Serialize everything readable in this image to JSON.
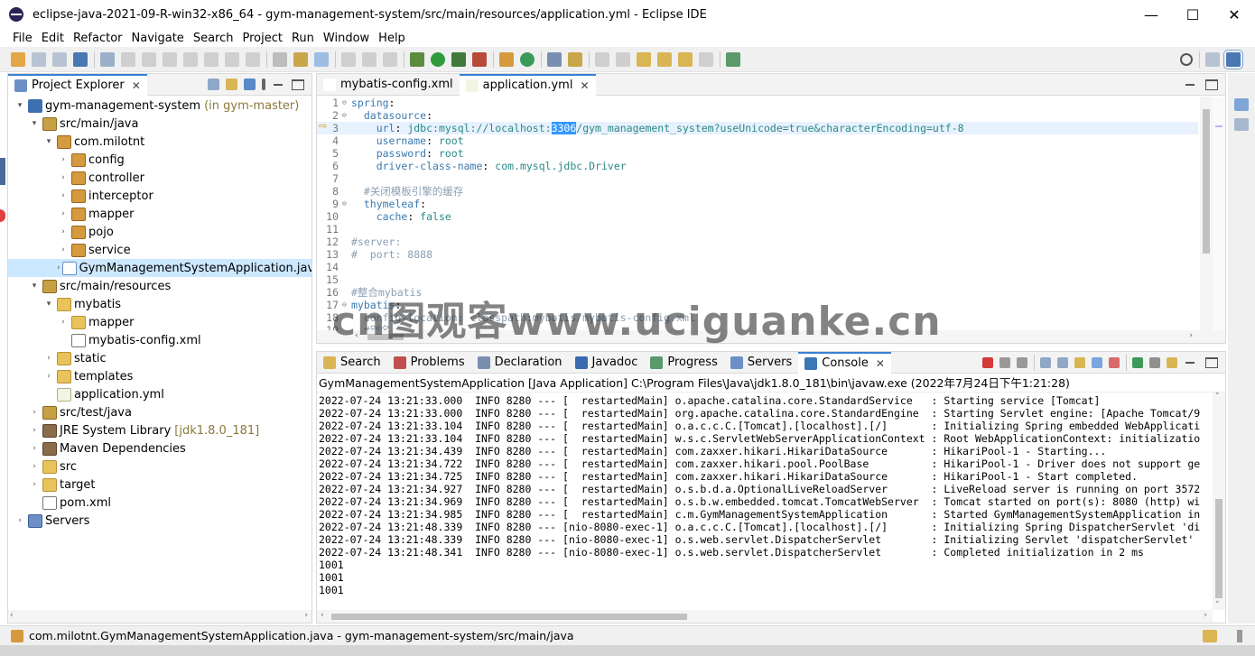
{
  "window": {
    "title": "eclipse-java-2021-09-R-win32-x86_64 - gym-management-system/src/main/resources/application.yml - Eclipse IDE",
    "minimize": "—",
    "maximize": "☐",
    "close": "✕"
  },
  "menu": [
    "File",
    "Edit",
    "Refactor",
    "Navigate",
    "Search",
    "Project",
    "Run",
    "Window",
    "Help"
  ],
  "explorer": {
    "title": "Project Explorer",
    "items": [
      {
        "label": "gym-management-system",
        "deco": "(in gym-master)",
        "icon": "project-icon",
        "indent": 0,
        "arrow": "▾"
      },
      {
        "label": "src/main/java",
        "deco": "",
        "icon": "source-folder-icon",
        "indent": 1,
        "arrow": "▾"
      },
      {
        "label": "com.milotnt",
        "deco": "",
        "icon": "package-icon",
        "indent": 2,
        "arrow": "▾"
      },
      {
        "label": "config",
        "deco": "",
        "icon": "package-icon",
        "indent": 3,
        "arrow": "›"
      },
      {
        "label": "controller",
        "deco": "",
        "icon": "package-icon",
        "indent": 3,
        "arrow": "›"
      },
      {
        "label": "interceptor",
        "deco": "",
        "icon": "package-icon",
        "indent": 3,
        "arrow": "›"
      },
      {
        "label": "mapper",
        "deco": "",
        "icon": "package-icon",
        "indent": 3,
        "arrow": "›"
      },
      {
        "label": "pojo",
        "deco": "",
        "icon": "package-icon",
        "indent": 3,
        "arrow": "›"
      },
      {
        "label": "service",
        "deco": "",
        "icon": "package-icon",
        "indent": 3,
        "arrow": "›"
      },
      {
        "label": "GymManagementSystemApplication.java",
        "deco": "",
        "icon": "java-file-icon",
        "indent": 3,
        "arrow": "›",
        "selected": true
      },
      {
        "label": "src/main/resources",
        "deco": "",
        "icon": "source-folder-icon",
        "indent": 1,
        "arrow": "▾"
      },
      {
        "label": "mybatis",
        "deco": "",
        "icon": "folder-icon",
        "indent": 2,
        "arrow": "▾"
      },
      {
        "label": "mapper",
        "deco": "",
        "icon": "folder-icon",
        "indent": 3,
        "arrow": "›"
      },
      {
        "label": "mybatis-config.xml",
        "deco": "",
        "icon": "xml-file-icon",
        "indent": 3,
        "arrow": ""
      },
      {
        "label": "static",
        "deco": "",
        "icon": "folder-icon",
        "indent": 2,
        "arrow": "›"
      },
      {
        "label": "templates",
        "deco": "",
        "icon": "folder-icon",
        "indent": 2,
        "arrow": "›"
      },
      {
        "label": "application.yml",
        "deco": "",
        "icon": "yml-file-icon",
        "indent": 2,
        "arrow": ""
      },
      {
        "label": "src/test/java",
        "deco": "",
        "icon": "source-folder-icon",
        "indent": 1,
        "arrow": "›"
      },
      {
        "label": "JRE System Library",
        "deco": "[jdk1.8.0_181]",
        "icon": "library-icon",
        "indent": 1,
        "arrow": "›"
      },
      {
        "label": "Maven Dependencies",
        "deco": "",
        "icon": "library-icon",
        "indent": 1,
        "arrow": "›"
      },
      {
        "label": "src",
        "deco": "",
        "icon": "folder-icon",
        "indent": 1,
        "arrow": "›"
      },
      {
        "label": "target",
        "deco": "",
        "icon": "folder-icon",
        "indent": 1,
        "arrow": "›"
      },
      {
        "label": "pom.xml",
        "deco": "",
        "icon": "xml-file-icon",
        "indent": 1,
        "arrow": ""
      },
      {
        "label": "Servers",
        "deco": "",
        "icon": "servers-icon",
        "indent": 0,
        "arrow": "›"
      }
    ]
  },
  "editor": {
    "tabs": [
      {
        "label": "mybatis-config.xml",
        "active": false
      },
      {
        "label": "application.yml",
        "active": true
      }
    ],
    "lines": [
      {
        "n": "1",
        "fold": "⊖",
        "segs": [
          {
            "t": "spring",
            "c": "k"
          },
          {
            "t": ":",
            "c": ""
          }
        ]
      },
      {
        "n": "2",
        "fold": "⊖",
        "segs": [
          {
            "t": "  datasource",
            "c": "k"
          },
          {
            "t": ":",
            "c": ""
          }
        ]
      },
      {
        "n": "3",
        "fold": "",
        "current": true,
        "segs": [
          {
            "t": "    url",
            "c": "k"
          },
          {
            "t": ": ",
            "c": ""
          },
          {
            "t": "jdbc:mysql://localhost:",
            "c": "v"
          },
          {
            "t": "3306",
            "c": "hl"
          },
          {
            "t": "/gym_management_system?useUnicode=true&characterEncoding=utf-8",
            "c": "v"
          }
        ]
      },
      {
        "n": "4",
        "fold": "",
        "segs": [
          {
            "t": "    username",
            "c": "k"
          },
          {
            "t": ": ",
            "c": ""
          },
          {
            "t": "root",
            "c": "v"
          }
        ]
      },
      {
        "n": "5",
        "fold": "",
        "segs": [
          {
            "t": "    password",
            "c": "k"
          },
          {
            "t": ": ",
            "c": ""
          },
          {
            "t": "root",
            "c": "v"
          }
        ]
      },
      {
        "n": "6",
        "fold": "",
        "segs": [
          {
            "t": "    driver-class-name",
            "c": "k"
          },
          {
            "t": ": ",
            "c": ""
          },
          {
            "t": "com.mysql.jdbc.Driver",
            "c": "v"
          }
        ]
      },
      {
        "n": "7",
        "fold": "",
        "segs": []
      },
      {
        "n": "8",
        "fold": "",
        "segs": [
          {
            "t": "  #关闭模板引擎的缓存",
            "c": "cm"
          }
        ]
      },
      {
        "n": "9",
        "fold": "⊖",
        "segs": [
          {
            "t": "  thymeleaf",
            "c": "k"
          },
          {
            "t": ":",
            "c": ""
          }
        ]
      },
      {
        "n": "10",
        "fold": "",
        "segs": [
          {
            "t": "    cache",
            "c": "k"
          },
          {
            "t": ": ",
            "c": ""
          },
          {
            "t": "false",
            "c": "v"
          }
        ]
      },
      {
        "n": "11",
        "fold": "",
        "segs": []
      },
      {
        "n": "12",
        "fold": "",
        "segs": [
          {
            "t": "#server:",
            "c": "cm"
          }
        ]
      },
      {
        "n": "13",
        "fold": "",
        "segs": [
          {
            "t": "#  port: 8888",
            "c": "cm"
          }
        ]
      },
      {
        "n": "14",
        "fold": "",
        "segs": []
      },
      {
        "n": "15",
        "fold": "",
        "segs": []
      },
      {
        "n": "16",
        "fold": "",
        "segs": [
          {
            "t": "#整合mybatis",
            "c": "cm"
          }
        ]
      },
      {
        "n": "17",
        "fold": "⊖",
        "segs": [
          {
            "t": "mybatis",
            "c": "k"
          },
          {
            "t": ":",
            "c": ""
          }
        ]
      },
      {
        "n": "18",
        "fold": "",
        "segs": [
          {
            "t": "  config-location: classpath:mybatis/mybatis-config.xml",
            "c": "cm"
          }
        ]
      },
      {
        "n": "19",
        "fold": "",
        "segs": [
          {
            "t": "  #别名",
            "c": "cm"
          }
        ]
      }
    ]
  },
  "console": {
    "tabs": [
      {
        "label": "Search",
        "active": false
      },
      {
        "label": "Problems",
        "active": false
      },
      {
        "label": "Declaration",
        "active": false
      },
      {
        "label": "Javadoc",
        "active": false
      },
      {
        "label": "Progress",
        "active": false
      },
      {
        "label": "Servers",
        "active": false
      },
      {
        "label": "Console",
        "active": true
      }
    ],
    "header": "GymManagementSystemApplication [Java Application] C:\\Program Files\\Java\\jdk1.8.0_181\\bin\\javaw.exe  (2022年7月24日下午1:21:28)",
    "lines": [
      "2022-07-24 13:21:33.000  INFO 8280 --- [  restartedMain] o.apache.catalina.core.StandardService   : Starting service [Tomcat]",
      "2022-07-24 13:21:33.000  INFO 8280 --- [  restartedMain] org.apache.catalina.core.StandardEngine  : Starting Servlet engine: [Apache Tomcat/9",
      "2022-07-24 13:21:33.104  INFO 8280 --- [  restartedMain] o.a.c.c.C.[Tomcat].[localhost].[/]       : Initializing Spring embedded WebApplicati",
      "2022-07-24 13:21:33.104  INFO 8280 --- [  restartedMain] w.s.c.ServletWebServerApplicationContext : Root WebApplicationContext: initializatio",
      "2022-07-24 13:21:34.439  INFO 8280 --- [  restartedMain] com.zaxxer.hikari.HikariDataSource       : HikariPool-1 - Starting...",
      "2022-07-24 13:21:34.722  INFO 8280 --- [  restartedMain] com.zaxxer.hikari.pool.PoolBase          : HikariPool-1 - Driver does not support ge",
      "2022-07-24 13:21:34.725  INFO 8280 --- [  restartedMain] com.zaxxer.hikari.HikariDataSource       : HikariPool-1 - Start completed.",
      "2022-07-24 13:21:34.927  INFO 8280 --- [  restartedMain] o.s.b.d.a.OptionalLiveReloadServer       : LiveReload server is running on port 3572",
      "2022-07-24 13:21:34.969  INFO 8280 --- [  restartedMain] o.s.b.w.embedded.tomcat.TomcatWebServer  : Tomcat started on port(s): 8080 (http) wi",
      "2022-07-24 13:21:34.985  INFO 8280 --- [  restartedMain] c.m.GymManagementSystemApplication       : Started GymManagementSystemApplication in",
      "2022-07-24 13:21:48.339  INFO 8280 --- [nio-8080-exec-1] o.a.c.c.C.[Tomcat].[localhost].[/]       : Initializing Spring DispatcherServlet 'di",
      "2022-07-24 13:21:48.339  INFO 8280 --- [nio-8080-exec-1] o.s.web.servlet.DispatcherServlet        : Initializing Servlet 'dispatcherServlet'",
      "2022-07-24 13:21:48.341  INFO 8280 --- [nio-8080-exec-1] o.s.web.servlet.DispatcherServlet        : Completed initialization in 2 ms",
      "1001",
      "1001",
      "1001"
    ]
  },
  "status": {
    "message": "com.milotnt.GymManagementSystemApplication.java - gym-management-system/src/main/java"
  },
  "watermark": "cn图观客www.uciguanke.cn",
  "colors": {
    "accent": "#3a7fd5",
    "selection": "#cce8ff",
    "yaml_key": "#3a7ab0",
    "yaml_value": "#2a8a86",
    "comment": "#8ba0b4"
  }
}
